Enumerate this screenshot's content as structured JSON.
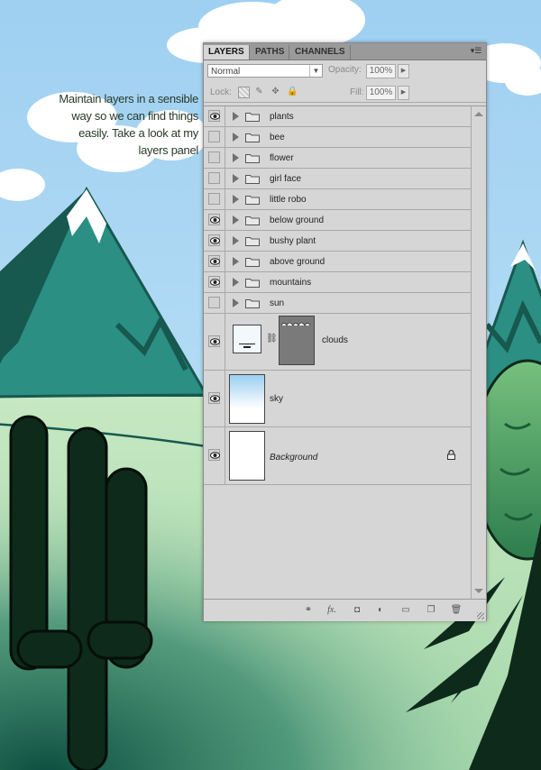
{
  "note": {
    "lines": [
      "Maintain layers in a sensible",
      "way so we can find things",
      "easily.  Take a look at my",
      "layers panel"
    ]
  },
  "panel": {
    "tabs": [
      "LAYERS",
      "PATHS",
      "CHANNELS"
    ],
    "active_tab": "LAYERS",
    "blend_mode": "Normal",
    "opacity_label": "Opacity:",
    "opacity_value": "100%",
    "lock_label": "Lock:",
    "fill_label": "Fill:",
    "fill_value": "100%",
    "layers": [
      {
        "name": "plants",
        "visible": true,
        "type": "group"
      },
      {
        "name": "bee",
        "visible": false,
        "type": "group"
      },
      {
        "name": "flower",
        "visible": false,
        "type": "group"
      },
      {
        "name": "girl face",
        "visible": false,
        "type": "group"
      },
      {
        "name": "little robo",
        "visible": false,
        "type": "group"
      },
      {
        "name": "below ground",
        "visible": true,
        "type": "group"
      },
      {
        "name": "bushy plant",
        "visible": true,
        "type": "group"
      },
      {
        "name": "above ground",
        "visible": true,
        "type": "group"
      },
      {
        "name": "mountains",
        "visible": true,
        "type": "group"
      },
      {
        "name": "sun",
        "visible": false,
        "type": "group"
      },
      {
        "name": "clouds",
        "visible": true,
        "type": "masked"
      },
      {
        "name": "sky",
        "visible": true,
        "type": "gradient"
      },
      {
        "name": "Background",
        "visible": true,
        "type": "background",
        "locked": true
      }
    ],
    "bottom_icons": [
      "link-icon",
      "fx-icon",
      "mask-icon",
      "adjustment-icon",
      "group-icon",
      "new-layer-icon",
      "trash-icon"
    ]
  },
  "colors": {
    "sky": "#a9d5f2",
    "mountain": "#2b8f83",
    "mountain_dark": "#17584f",
    "ground": "#b7dfb6",
    "cactus": "#0e2a1b",
    "panel_bg": "#d6d6d6"
  }
}
